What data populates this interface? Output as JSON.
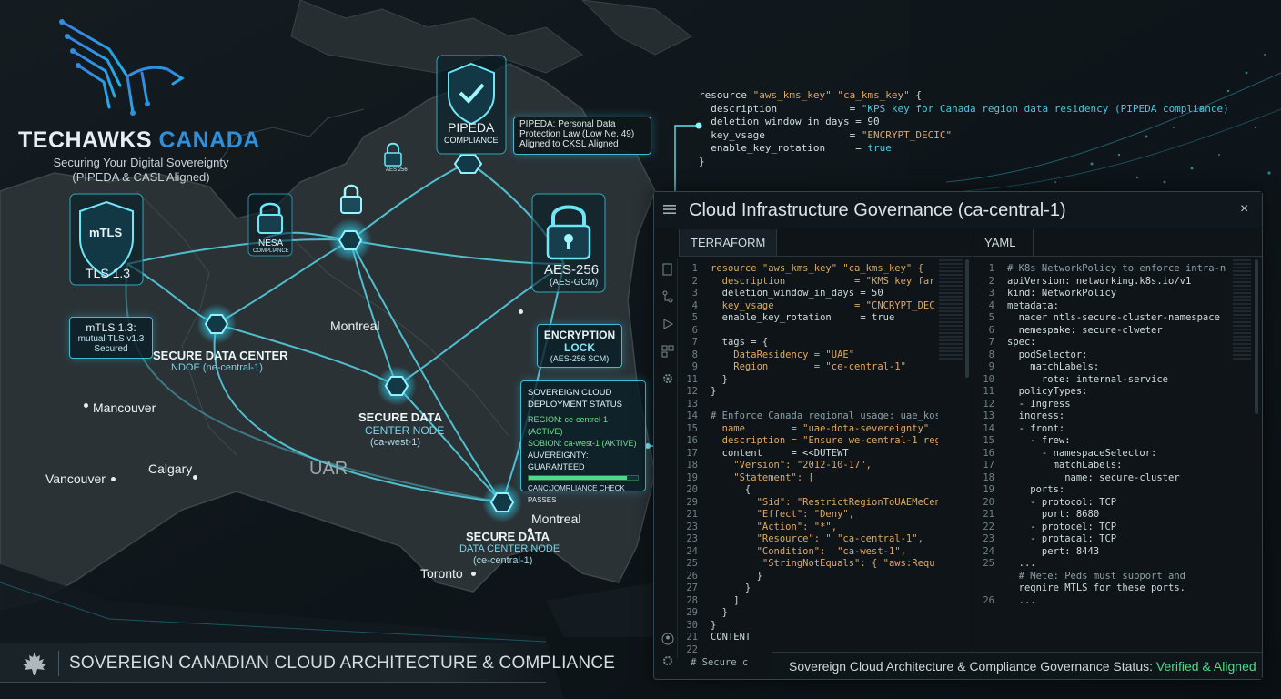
{
  "brand": {
    "name_part1": "TECHAWKS",
    "name_part2": "CANADA",
    "tagline1": "Securing Your Digital Sovereignty",
    "tagline2": "(PIPEDA & CASL Aligned)"
  },
  "badges": {
    "mtls_title": "mTLS",
    "mtls_sub": "TLS 1.3",
    "mtls_caption1": "mTLS 1.3:",
    "mtls_caption2": "mutual TLS v1.3",
    "mtls_caption3": "Secured",
    "nesa_title": "NESA",
    "nesa_sub": "COMPLIANCE",
    "lock_small": "AES 256",
    "pipeda_title": "PIPEDA",
    "pipeda_sub": "COMPLIANCE",
    "pipeda_note1": "PIPEDA: Personal Data",
    "pipeda_note2": "Protection Law (Low Ne. 49)",
    "pipeda_note3": "Aligned to CKSL Aligned",
    "aes_title": "AES-256",
    "aes_sub": "(AES-GCM)",
    "enc_title1": "ENCRYPTION",
    "enc_title2": "LOCK",
    "enc_sub": "(AES-256 SCM)"
  },
  "nodes": {
    "n1_title": "SECURE DATA CENTER",
    "n1_sub": "NDOE (ne-central-1)",
    "n2_title1": "SECURE DATA",
    "n2_title2": "CENTER NODE",
    "n2_sub": "(ca-west-1)",
    "n3_title": "SECURE DATA",
    "n3_sub1": "DATA CENTER NODE",
    "n3_sub2": "(ce-central-1)"
  },
  "cities": {
    "c1": "Montreal",
    "c2": "Mancouver",
    "c3": "Vancouver",
    "c4": "Calgary",
    "c5": "UAR",
    "c6": "Montreal",
    "c7": "Toronto"
  },
  "status_panel": {
    "header1": "SOVEREIGN CLOUD",
    "header2": "DEPLOYMENT STATUS",
    "row1": "REGION: ce-centrel-1 (ACTIVE)",
    "row2": "SOBION: ca-west-1 (AKTIVE)",
    "row3": "AUVEREIGNTY: GUARANTEED",
    "row4": "CANC:JOMRLIANCE CHECK PASSES",
    "progress": 0.9
  },
  "floating_code": {
    "l1a": "resource ",
    "l1b": "\"aws_kms_key\"",
    "l1c": " ",
    "l1d": "\"ca_kms_key\"",
    "l1e": " {",
    "l2a": "  description            = ",
    "l2b": "\"KPS key for Canada region data residency (PIPEDA compliance)",
    "l3": "  deletion_window_in_days = 90",
    "l4a": "  key_vsage              = ",
    "l4b": "\"ENCRYPT_DECIC\"",
    "l5a": "  enable_key_rotation     = ",
    "l5b": "true",
    "l6": "}"
  },
  "window": {
    "title": "Cloud Infrastructure Governance (ca-central-1)",
    "close": "×",
    "tab_left": "TERRAFORM",
    "tab_right": "YAML",
    "status_prefix": "Sovereign Cloud Architecture & Compliance Governance Status: ",
    "status_ok": "Verified & Aligned",
    "bottom_code": "# Secure c"
  },
  "terraform_lines": [
    {
      "n": "1",
      "t": "resource \"aws_kms_key\" \"ca_kms_key\" {"
    },
    {
      "n": "2",
      "t": "  description            = \"KMS key far"
    },
    {
      "n": "3",
      "t": "  deletion_window_in_days = 50"
    },
    {
      "n": "4",
      "t": "  key_vsage              = \"CNCRYPT_DEC"
    },
    {
      "n": "5",
      "t": "  enable_key_rotation     = true"
    },
    {
      "n": "6",
      "t": ""
    },
    {
      "n": "7",
      "t": "  tags = {"
    },
    {
      "n": "8",
      "t": "    DataResidency = \"UAE\""
    },
    {
      "n": "9",
      "t": "    Region        = \"ce-central-1\""
    },
    {
      "n": "11",
      "t": "  }"
    },
    {
      "n": "12",
      "t": "}"
    },
    {
      "n": "13",
      "t": ""
    },
    {
      "n": "14",
      "t": "# Enforce Canada regional usage: uae_kos"
    },
    {
      "n": "15",
      "t": "  name        = \"uae-dota-severeignty\""
    },
    {
      "n": "16",
      "t": "  description = \"Ensure we-central-1 reg"
    },
    {
      "n": "17",
      "t": "  content     = <<DUTEWT"
    },
    {
      "n": "18",
      "t": "    \"Version\": \"2012-10-17\","
    },
    {
      "n": "19",
      "t": "    \"Statement\": ["
    },
    {
      "n": "20",
      "t": "      {"
    },
    {
      "n": "29",
      "t": "        \"Sid\": \"RestrictRegionToUAEMeCen"
    },
    {
      "n": "21",
      "t": "        \"Effect\": \"Deny\","
    },
    {
      "n": "23",
      "t": "        \"Action\": \"*\","
    },
    {
      "n": "23",
      "t": "        \"Resource\": \" \"ca-central-1\","
    },
    {
      "n": "24",
      "t": "        \"Condition\":  \"ca-west-1\","
    },
    {
      "n": "25",
      "t": "         \"StringNotEquals\": { \"aws:Requ"
    },
    {
      "n": "26",
      "t": "        }"
    },
    {
      "n": "27",
      "t": "      }"
    },
    {
      "n": "28",
      "t": "    ]"
    },
    {
      "n": "29",
      "t": "  }"
    },
    {
      "n": "30",
      "t": "}"
    },
    {
      "n": "21",
      "t": "CONTENT"
    },
    {
      "n": "22",
      "t": ""
    }
  ],
  "yaml_lines": [
    {
      "n": "1",
      "t": "# K8s NetworkPolicy to enforce intra-n"
    },
    {
      "n": "2",
      "t": "apiVersion: networking.k8s.io/v1"
    },
    {
      "n": "3",
      "t": "kind: NetworkPolicy"
    },
    {
      "n": "4",
      "t": "metadata:"
    },
    {
      "n": "5",
      "t": "  nacer ntls-secure-cluster-namespace"
    },
    {
      "n": "6",
      "t": "  nemespake: secure-clweter"
    },
    {
      "n": "7",
      "t": "spec:"
    },
    {
      "n": "8",
      "t": "  podSelector:"
    },
    {
      "n": "9",
      "t": "    matchLabels:"
    },
    {
      "n": "10",
      "t": "      rote: internal-service"
    },
    {
      "n": "11",
      "t": "  policyTypes:"
    },
    {
      "n": "12",
      "t": "  - Ingress"
    },
    {
      "n": "13",
      "t": "  ingress:"
    },
    {
      "n": "14",
      "t": "  - front:"
    },
    {
      "n": "15",
      "t": "    - frew:"
    },
    {
      "n": "16",
      "t": "      - namespaceSelector:"
    },
    {
      "n": "17",
      "t": "        matchLabels:"
    },
    {
      "n": "18",
      "t": "          name: secure-cluster"
    },
    {
      "n": "19",
      "t": "    ports:"
    },
    {
      "n": "20",
      "t": "    - protocol: TCP"
    },
    {
      "n": "21",
      "t": "      port: 8680"
    },
    {
      "n": "22",
      "t": "    - protocel: TCP"
    },
    {
      "n": "23",
      "t": "    - protacal: TCP"
    },
    {
      "n": "24",
      "t": "      pert: 8443"
    },
    {
      "n": "25",
      "t": "  ..."
    },
    {
      "n": "",
      "t": "  # Mete: Peds must support and"
    },
    {
      "n": "",
      "t": "  reqnire MTLS for these ports."
    },
    {
      "n": "26",
      "t": "  ..."
    }
  ],
  "banner": {
    "text": "SOVEREIGN CANADIAN CLOUD ARCHITECTURE & COMPLIANCE"
  },
  "colors": {
    "accent_cyan": "#3dd0e6",
    "brand_blue": "#2f8fd8",
    "ok_green": "#4fd98a"
  }
}
